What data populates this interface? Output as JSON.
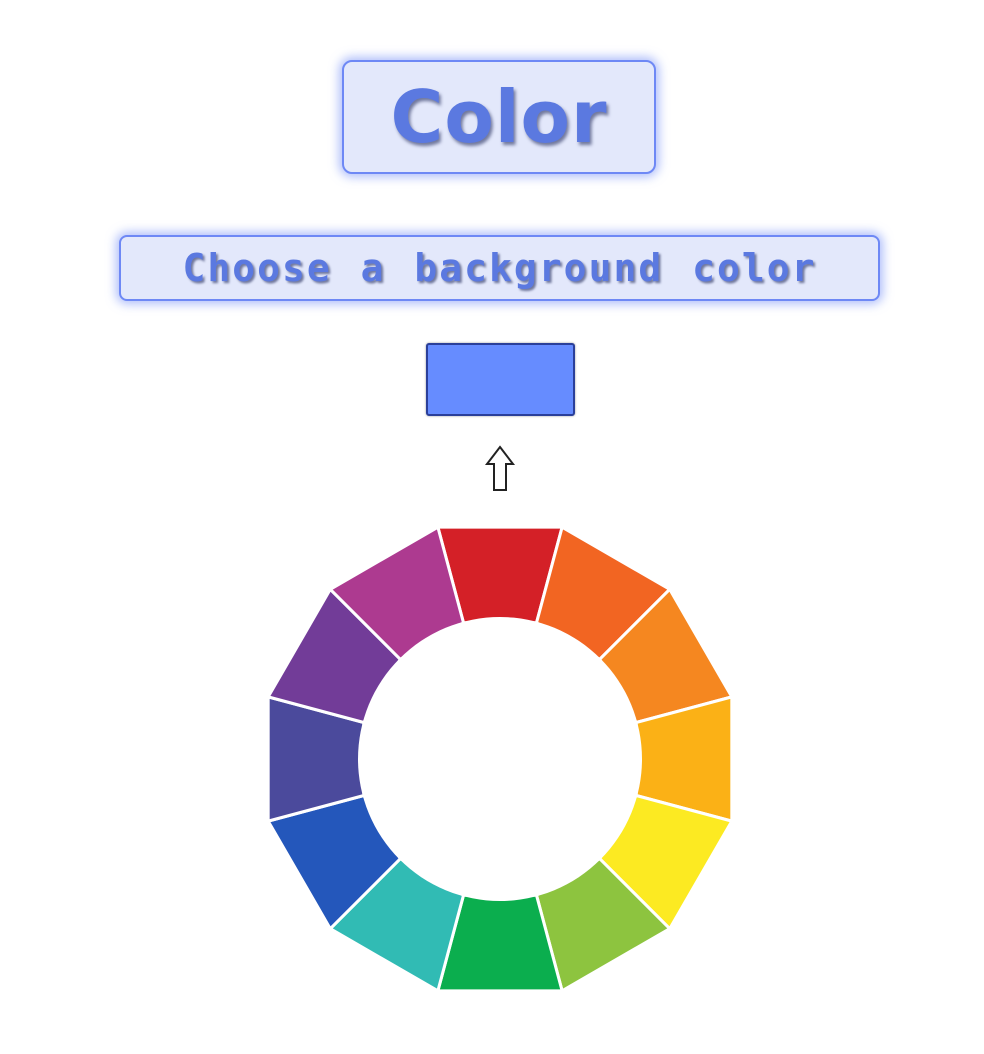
{
  "header": {
    "title": "Color"
  },
  "prompt": {
    "text": "Choose a background color"
  },
  "preview": {
    "selected_color": "#668cff"
  },
  "arrow": {
    "icon": "up-arrow-icon"
  },
  "color_wheel": {
    "segments": [
      {
        "name": "red",
        "color": "#d42027"
      },
      {
        "name": "red-orange",
        "color": "#f26522"
      },
      {
        "name": "orange",
        "color": "#f58720"
      },
      {
        "name": "yellow-orange",
        "color": "#fbb116"
      },
      {
        "name": "yellow",
        "color": "#fcea22"
      },
      {
        "name": "yellow-green",
        "color": "#8dc43f"
      },
      {
        "name": "green",
        "color": "#0bae4e"
      },
      {
        "name": "blue-green",
        "color": "#31bbb4"
      },
      {
        "name": "blue",
        "color": "#2457bb"
      },
      {
        "name": "blue-violet",
        "color": "#4b4a9c"
      },
      {
        "name": "violet",
        "color": "#723c98"
      },
      {
        "name": "red-violet",
        "color": "#ad3a90"
      }
    ]
  }
}
